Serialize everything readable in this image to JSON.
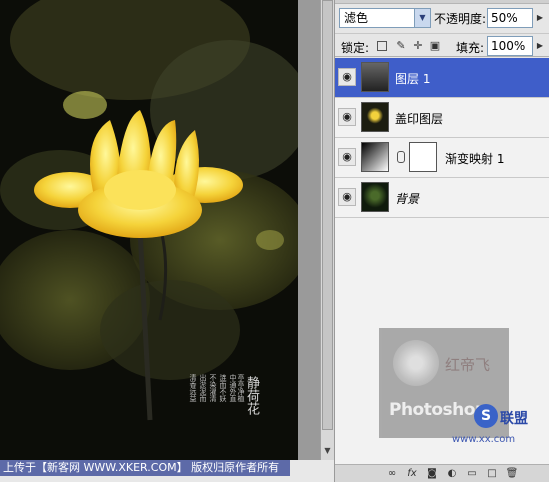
{
  "caption": {
    "text": "上传于【新客网 WWW.XKER.COM】 版权归原作者所有"
  },
  "poem": {
    "title": "静荷花",
    "lines": [
      "清香远益",
      "出淤泥而",
      "不染濯清",
      "涟而不妖",
      "中通外直",
      "亭亭净植"
    ]
  },
  "layers_panel": {
    "blend_mode": "滤色",
    "opacity_label": "不透明度:",
    "opacity_value": "50%",
    "lock_label": "锁定:",
    "fill_label": "填充:",
    "fill_value": "100%",
    "layers": [
      {
        "name": "图层 1",
        "selected": true,
        "visible": true
      },
      {
        "name": "盖印图层",
        "selected": false,
        "visible": true
      },
      {
        "name": "渐变映射 1",
        "selected": false,
        "visible": true
      },
      {
        "name": "背景",
        "selected": false,
        "visible": true,
        "italic": true
      }
    ]
  },
  "watermark": {
    "text": "Photoshop",
    "sub": "红帝飞"
  },
  "site_logo": {
    "text": "联盟",
    "sub": "www.xx.com"
  },
  "icons": {
    "eye": "eye-icon",
    "lock_transparent": "lock-transparent-icon",
    "brush": "brush-icon",
    "move": "move-icon",
    "lock": "lock-icon"
  }
}
